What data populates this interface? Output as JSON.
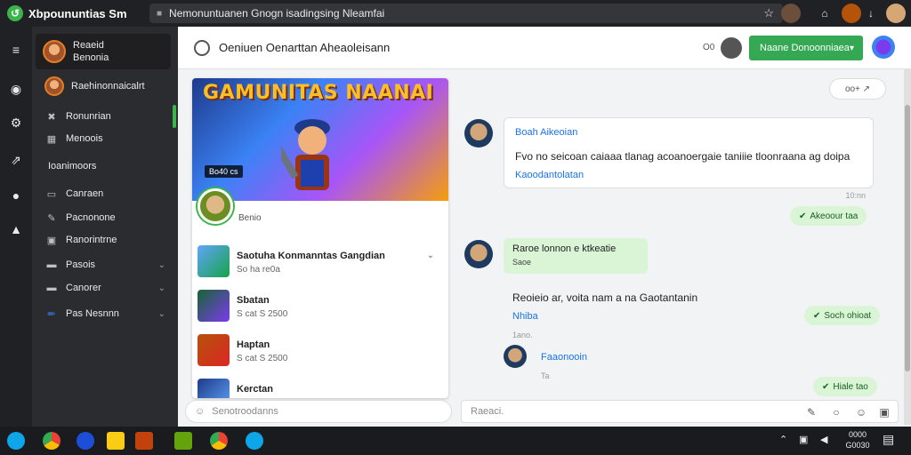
{
  "browser": {
    "app_title": "Xbpoununtias Sm",
    "url": "Nemonuntuanen Gnogn isadingsing Nleamfai",
    "colors": {
      "accent_green": "#34a853",
      "link_blue": "#1a73e8",
      "dark_bg": "#202124"
    }
  },
  "sidebar": {
    "profile": {
      "name": "Reaeid",
      "sub": "Benonia"
    },
    "active_item": "Raehinonnaicalrt",
    "items": [
      {
        "label": "Ronunrian",
        "icon": "shield-icon"
      },
      {
        "label": "Menoois",
        "icon": "grid-icon"
      },
      {
        "label": "Ioanimoors",
        "icon": ""
      },
      {
        "label": "Canraen",
        "icon": "document-icon"
      },
      {
        "label": "Pacnonone",
        "icon": "pencil-icon"
      },
      {
        "label": "Ranorintrne",
        "icon": "image-icon"
      },
      {
        "label": "Pasois",
        "icon": "folder-icon"
      },
      {
        "label": "Canorer",
        "icon": "folder-icon"
      },
      {
        "label": "Pas Nesnnn",
        "icon": "edit-icon"
      }
    ]
  },
  "header": {
    "title": "Oeniuen Oenarttan  Aheaoleisann",
    "button_label": "Naane Donoonniaea",
    "counter": "O0"
  },
  "card": {
    "banner_title": "GAMUNITAS NAANAI",
    "banner_tag": "Bo40 cs",
    "profile_name": "Benio",
    "list": [
      {
        "title": "Saotuha  Konmanntas Gangdian",
        "sub": "So  ha  re0a"
      },
      {
        "title": "Sbatan",
        "sub": "S  cat  S  2500"
      },
      {
        "title": "Haptan",
        "sub": "S  cat  S  2500"
      },
      {
        "title": "Kerctan",
        "sub": ""
      }
    ],
    "composer_placeholder": "Senotroodanns"
  },
  "chat": {
    "top_pill": "oo+  ↗",
    "msg1": {
      "name": "Boah Aikeoian",
      "text": "Fvo no seicoan caiaaa tlanag acoanoergaie taniiie  tloonraana ag doipa",
      "link": "Kaoodantolatan",
      "time": "10:nn"
    },
    "pill1": "Akeoour taa",
    "msg2": {
      "name": "Raroe lonnon e ktkeatie",
      "sub": "Saoe"
    },
    "text2": "Reoieio ar, voita nam a na Gaotantanin",
    "link2": "Nhiba",
    "pill2": "Soch ohioat",
    "small1": "1ano.",
    "reply": {
      "name": "Faaonooin"
    },
    "small2": "Ta",
    "pill3": "Hiale tao",
    "composer_placeholder": "Raeaci."
  },
  "taskbar": {
    "clock_time": "0000",
    "clock_date": "G0030"
  }
}
